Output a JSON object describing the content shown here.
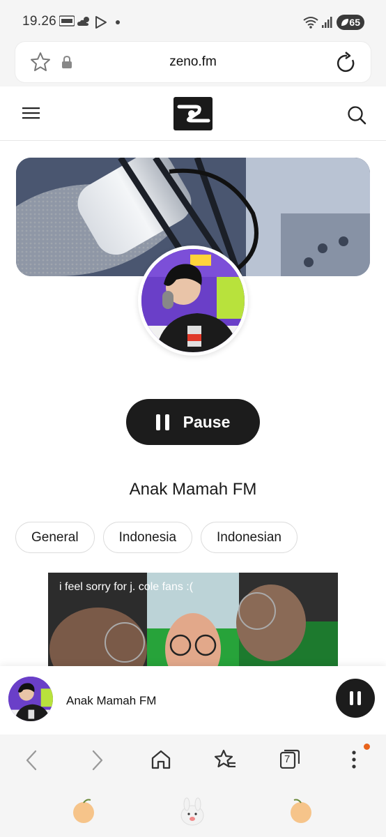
{
  "status_bar": {
    "time": "19.26",
    "battery": "65",
    "icons": [
      "kuk-badge-icon",
      "cloud-sun-icon",
      "play-store-icon",
      "dot-icon",
      "wifi-icon",
      "signal-icon",
      "battery-icon"
    ]
  },
  "address_bar": {
    "url": "zeno.fm",
    "icons": [
      "bookmark-star-icon",
      "lock-icon",
      "reload-icon"
    ]
  },
  "site_header": {
    "icons": [
      "menu-icon",
      "zeno-logo",
      "search-icon"
    ]
  },
  "station": {
    "pause_label": "Pause",
    "title": "Anak Mamah FM",
    "tags": [
      "General",
      "Indonesia",
      "Indonesian"
    ]
  },
  "video": {
    "caption": "i feel sorry for j. cole fans :("
  },
  "mini_player": {
    "title": "Anak Mamah FM"
  },
  "browser_nav": {
    "tab_count": "7",
    "icons": [
      "back-icon",
      "forward-icon",
      "home-icon",
      "bookmarks-icon",
      "tabs-icon",
      "more-icon"
    ]
  },
  "colors": {
    "accent_dark": "#1c1c1c",
    "notification": "#e8631c",
    "avatar_bg": "#6a3fc8"
  }
}
